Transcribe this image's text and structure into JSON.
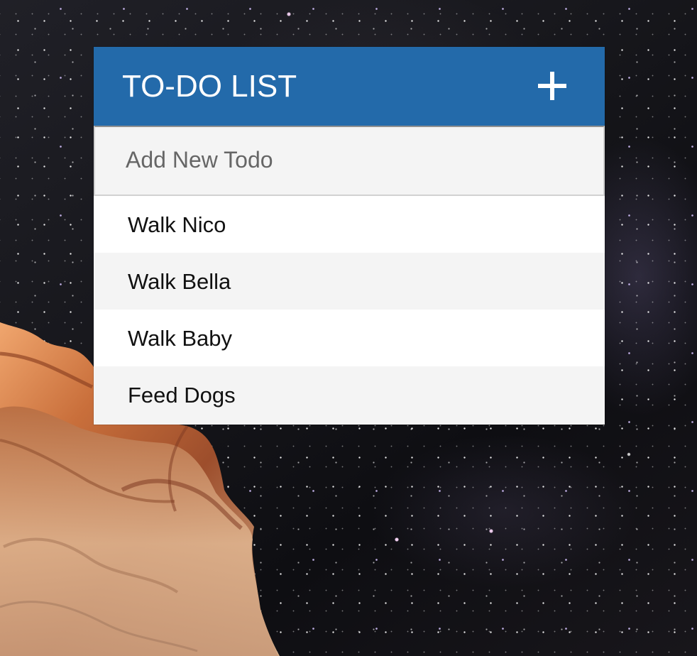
{
  "background": {
    "description_icon": "starry-night-cliff",
    "sky_color": "#17171c",
    "rock_color": "#b46537"
  },
  "todo": {
    "title": "TO-DO LIST",
    "add_icon": "plus-icon",
    "input": {
      "placeholder": "Add New Todo",
      "value": ""
    },
    "items": [
      {
        "text": "Walk Nico"
      },
      {
        "text": "Walk Bella"
      },
      {
        "text": "Walk Baby"
      },
      {
        "text": "Feed Dogs"
      }
    ],
    "colors": {
      "header": "#236aaa",
      "header_text": "#ffffff",
      "input_background": "#f4f4f4",
      "item_text": "#111111"
    }
  }
}
